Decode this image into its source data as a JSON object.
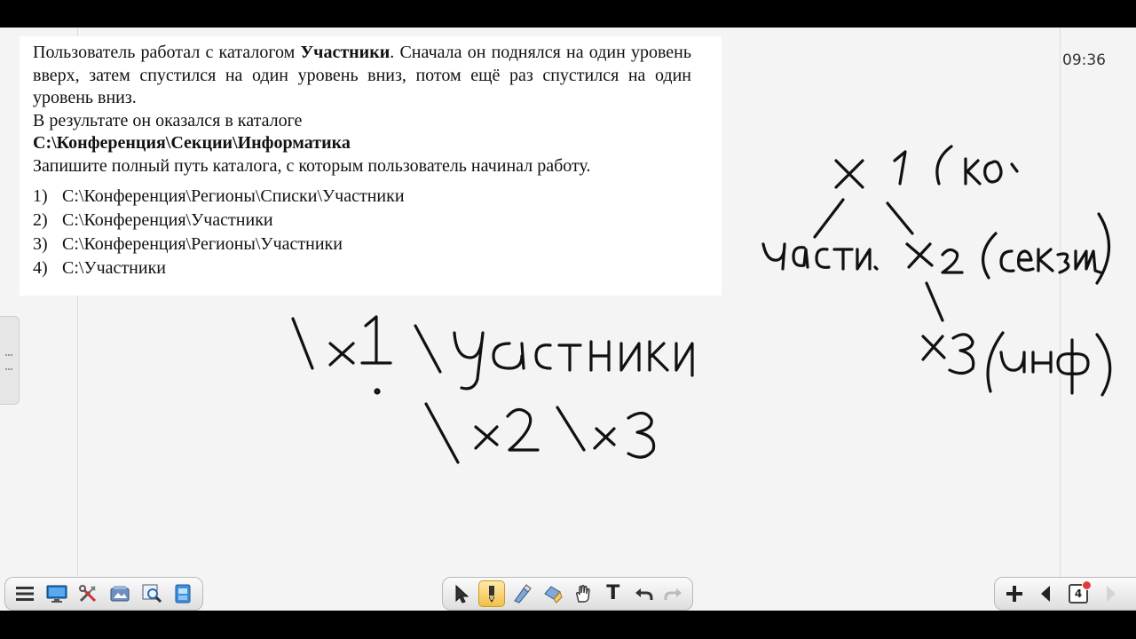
{
  "clock": "09:36",
  "question": {
    "p1_start": "Пользователь работал с каталогом ",
    "p1_bold": "Участники",
    "p1_end": ". Сначала он поднялся на один уровень вверх, затем спустился на один уровень вниз, потом ещё раз спустился на один уровень вниз.",
    "p2": "В результате он оказался в каталоге",
    "path_bold": "С:\\Конференция\\Секции\\Информатика",
    "p3": "Запишите полный путь каталога, с которым пользователь начинал работу.",
    "options": [
      {
        "num": "1)",
        "text": "С:\\Конференция\\Регионы\\Списки\\Участники"
      },
      {
        "num": "2)",
        "text": "С:\\Конференция\\Участники"
      },
      {
        "num": "3)",
        "text": "С:\\Конференция\\Регионы\\Участники"
      },
      {
        "num": "4)",
        "text": "С:\\Участники"
      }
    ]
  },
  "toolbar_left": {
    "items": [
      "menu-icon",
      "display-icon",
      "tools-icon",
      "gallery-icon",
      "magnifier-icon",
      "app-icon"
    ]
  },
  "toolbar_center": {
    "items": [
      "cursor-icon",
      "pen-icon",
      "highlighter-icon",
      "eraser-icon",
      "hand-icon",
      "text-tool-icon",
      "undo-icon",
      "redo-icon"
    ],
    "text_tool_glyph": "T",
    "active": "pen-icon"
  },
  "toolbar_right": {
    "page_number": "4",
    "items": [
      "add-page-icon",
      "previous-page-icon",
      "page-indicator",
      "next-page-icon"
    ]
  },
  "colors": {
    "board": "#f4f4f4",
    "card": "#ffffff",
    "ink": "#111111",
    "active_tool": "#f0c14a"
  }
}
